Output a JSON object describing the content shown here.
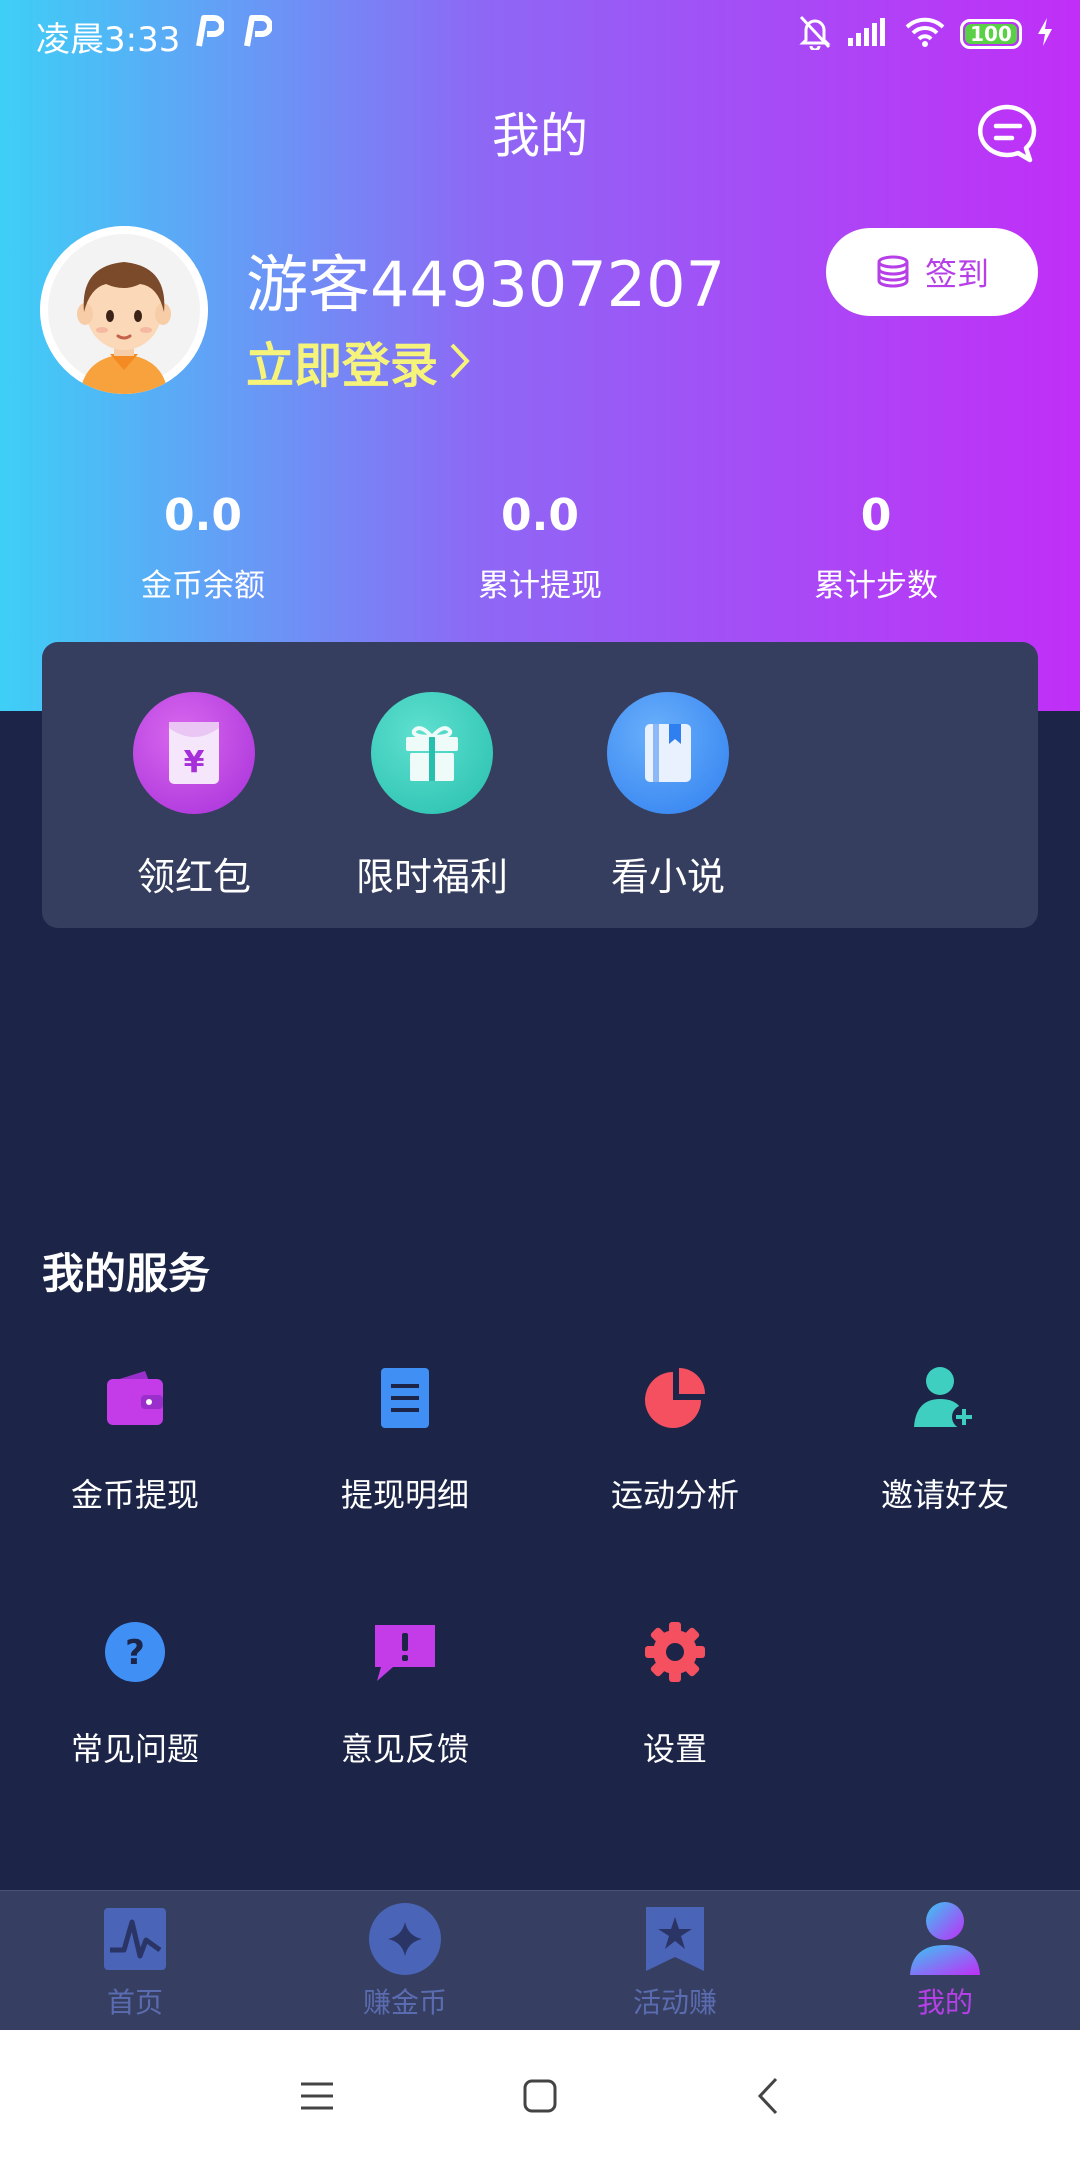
{
  "status_bar": {
    "time": "凌晨3:33",
    "battery": "100",
    "icons": [
      "p-app-icon",
      "p-app-icon",
      "mute-bell-icon",
      "signal-icon",
      "wifi-icon",
      "battery-icon",
      "charging-icon"
    ]
  },
  "header": {
    "title": "我的",
    "message_icon": "chat-bubble-icon"
  },
  "profile": {
    "username": "游客449307207",
    "login_text": "立即登录",
    "signin_label": "签到",
    "signin_icon": "coins-icon"
  },
  "stats": [
    {
      "value": "0.0",
      "label": "金币余额"
    },
    {
      "value": "0.0",
      "label": "累计提现"
    },
    {
      "value": "0",
      "label": "累计步数"
    }
  ],
  "quick_actions": [
    {
      "label": "领红包",
      "icon": "red-envelope-icon",
      "color": "#b43ee6"
    },
    {
      "label": "限时福利",
      "icon": "gift-icon",
      "color": "#2fcfbc"
    },
    {
      "label": "看小说",
      "icon": "book-icon",
      "color": "#3f8ff5"
    }
  ],
  "services": {
    "title": "我的服务",
    "items": [
      {
        "label": "金币提现",
        "icon": "wallet-icon",
        "color": "#c33ce8"
      },
      {
        "label": "提现明细",
        "icon": "document-icon",
        "color": "#3f8ff5"
      },
      {
        "label": "运动分析",
        "icon": "pie-chart-icon",
        "color": "#f5505f"
      },
      {
        "label": "邀请好友",
        "icon": "add-user-icon",
        "color": "#3fcfc0"
      },
      {
        "label": "常见问题",
        "icon": "question-icon",
        "color": "#3f8ff5"
      },
      {
        "label": "意见反馈",
        "icon": "feedback-icon",
        "color": "#c33ce8"
      },
      {
        "label": "设置",
        "icon": "gear-icon",
        "color": "#f5505f"
      }
    ]
  },
  "tabbar": {
    "tabs": [
      {
        "label": "首页",
        "icon": "pulse-icon",
        "active": false
      },
      {
        "label": "赚金币",
        "icon": "sparkle-coin-icon",
        "active": false
      },
      {
        "label": "活动赚",
        "icon": "star-bookmark-icon",
        "active": false
      },
      {
        "label": "我的",
        "icon": "user-icon",
        "active": true
      }
    ],
    "active_color": "#b73fe8",
    "inactive_color": "#5b6bb0"
  },
  "system_nav": {
    "icons": [
      "menu-icon",
      "home-icon",
      "back-icon"
    ]
  }
}
